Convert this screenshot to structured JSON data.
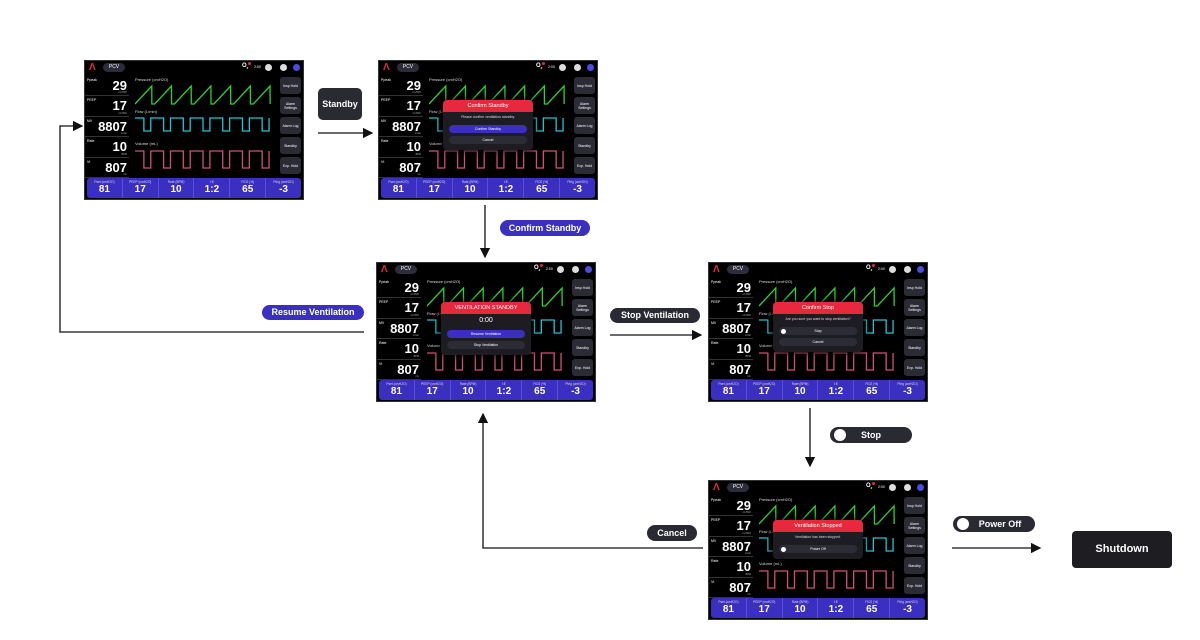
{
  "screen": {
    "mode": "PCV",
    "time": "2:00",
    "o2_label": "O2",
    "metrics": [
      {
        "label": "Ppeak",
        "value": "29",
        "unit": "cmH2O"
      },
      {
        "label": "PEEP",
        "value": "17",
        "unit": "cmH2O"
      },
      {
        "label": "MV",
        "value": "8807",
        "unit": "L/min"
      },
      {
        "label": "Rate",
        "value": "10",
        "unit": "BPM"
      },
      {
        "label": "Vt",
        "value": "807",
        "unit": "mL"
      }
    ],
    "charts": [
      {
        "label": "Pressure (cmH2O)",
        "color": "#2fd12f"
      },
      {
        "label": "Flow (L/min)",
        "color": "#22c4d4"
      },
      {
        "label": "Volume (mL)",
        "color": "#d0507a"
      }
    ],
    "buttons": [
      "Insp Hold",
      "Alarm Settings",
      "Alarm Log",
      "Standby",
      "Exp. Hold"
    ],
    "settings": [
      {
        "label": "Pset (cmH2O)",
        "value": "81"
      },
      {
        "label": "PEEP (cmH2O)",
        "value": "17"
      },
      {
        "label": "Rate (BPM)",
        "value": "10"
      },
      {
        "label": "I:E",
        "value": "1:2"
      },
      {
        "label": "FiO2 (%)",
        "value": "65"
      },
      {
        "label": "Ptrig (cmH2O)",
        "value": "-3"
      }
    ]
  },
  "dialogs": {
    "confirm_standby": {
      "title": "Confirm Standby",
      "text": "Please confirm ventilation standby.",
      "buttons": [
        "Confirm Standby",
        "Cancel"
      ]
    },
    "standby": {
      "title": "VENTILATION STANDBY",
      "timer": "0:00",
      "buttons": [
        "Resume Ventilation",
        "Stop Ventilation"
      ]
    },
    "confirm_stop": {
      "title": "Confirm Stop",
      "text": "Are you sure you want to stop ventilation?",
      "buttons": [
        "Stop",
        "Cancel"
      ]
    },
    "stopped": {
      "title": "Ventilation Stopped",
      "text": "Ventilation has been stopped.",
      "buttons": [
        "Power Off"
      ]
    }
  },
  "flow": {
    "standby": "Standby",
    "confirm_standby": "Confirm Standby",
    "resume": "Resume Ventilation",
    "stop_ventilation": "Stop Ventilation",
    "stop": "Stop",
    "cancel": "Cancel",
    "power_off": "Power Off",
    "shutdown": "Shutdown"
  },
  "colors": {
    "accent": "#3a2fc0",
    "alert": "#e8283c"
  }
}
